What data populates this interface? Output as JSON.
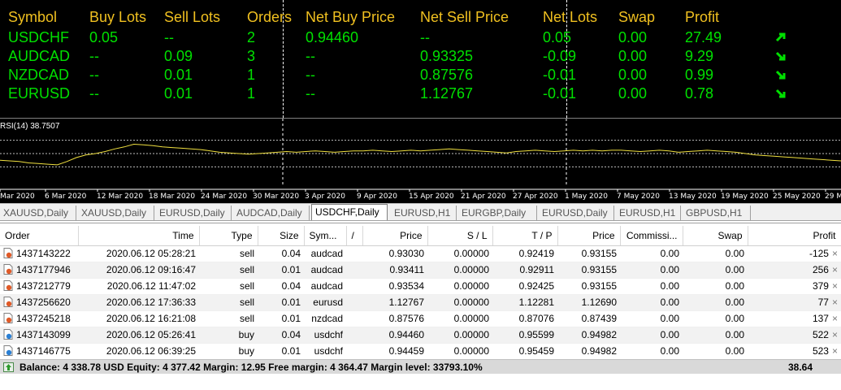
{
  "summary": {
    "headers": [
      "Symbol",
      "Buy Lots",
      "Sell Lots",
      "Orders",
      "Net Buy Price",
      "Net Sell Price",
      "Net Lots",
      "Swap",
      "Profit"
    ],
    "rows": [
      {
        "symbol": "USDCHF",
        "buy_lots": "0.05",
        "sell_lots": "--",
        "orders": "2",
        "net_buy_price": "0.94460",
        "net_sell_price": "--",
        "net_lots": "0.05",
        "swap": "0.00",
        "profit": "27.49",
        "arrow": "arrow-up-right-icon"
      },
      {
        "symbol": "AUDCAD",
        "buy_lots": "--",
        "sell_lots": "0.09",
        "orders": "3",
        "net_buy_price": "--",
        "net_sell_price": "0.93325",
        "net_lots": "-0.09",
        "swap": "0.00",
        "profit": "9.29",
        "arrow": "arrow-down-right-icon"
      },
      {
        "symbol": "NZDCAD",
        "buy_lots": "--",
        "sell_lots": "0.01",
        "orders": "1",
        "net_buy_price": "--",
        "net_sell_price": "0.87576",
        "net_lots": "-0.01",
        "swap": "0.00",
        "profit": "0.99",
        "arrow": "arrow-down-right-icon"
      },
      {
        "symbol": "EURUSD",
        "buy_lots": "--",
        "sell_lots": "0.01",
        "orders": "1",
        "net_buy_price": "--",
        "net_sell_price": "1.12767",
        "net_lots": "-0.01",
        "swap": "0.00",
        "profit": "0.78",
        "arrow": "arrow-down-right-icon"
      }
    ],
    "colors": {
      "header": "#f0c020",
      "value": "#00e000",
      "background": "#000000"
    }
  },
  "rsi": {
    "label": "RSI(14) 38.7507",
    "dates": [
      "Mar 2020",
      "6 Mar 2020",
      "12 Mar 2020",
      "18 Mar 2020",
      "24 Mar 2020",
      "30 Mar 2020",
      "3 Apr 2020",
      "9 Apr 2020",
      "15 Apr 2020",
      "21 Apr 2020",
      "27 Apr 2020",
      "1 May 2020",
      "7 May 2020",
      "13 May 2020",
      "19 May 2020",
      "25 May 2020",
      "29 M"
    ],
    "levels": [
      70,
      50,
      30
    ],
    "values": [
      40,
      39,
      38,
      36,
      35,
      34,
      33,
      38,
      44,
      48,
      50,
      53,
      57,
      60,
      64,
      63,
      62,
      60,
      59,
      58,
      57,
      56,
      54,
      52,
      51,
      50,
      49,
      50,
      51,
      52,
      53,
      52,
      53,
      54,
      53,
      52,
      53,
      54,
      54,
      55,
      54,
      53,
      54,
      55,
      54,
      55,
      56,
      57,
      56,
      55,
      54,
      53,
      52,
      51,
      53,
      54,
      55,
      54,
      53,
      54,
      55,
      54,
      55,
      54,
      55,
      55,
      54,
      53,
      54,
      55,
      54,
      52,
      53,
      54,
      55,
      54,
      53,
      52,
      50,
      48,
      47,
      46,
      45,
      44,
      43,
      42,
      41,
      40,
      39
    ],
    "line_color": "#f0e040"
  },
  "tabs": [
    {
      "label": "XAUUSD,Daily",
      "active": false
    },
    {
      "label": "XAUUSD,Daily",
      "active": false
    },
    {
      "label": "EURUSD,Daily",
      "active": false
    },
    {
      "label": "AUDCAD,Daily",
      "active": false
    },
    {
      "label": "USDCHF,Daily",
      "active": true
    },
    {
      "label": "EURUSD,H1",
      "active": false
    },
    {
      "label": "EURGBP,Daily",
      "active": false
    },
    {
      "label": "EURUSD,Daily",
      "active": false
    },
    {
      "label": "EURUSD,H1",
      "active": false
    },
    {
      "label": "GBPUSD,H1",
      "active": false
    }
  ],
  "orders": {
    "columns": [
      "Order",
      "Time",
      "Type",
      "Size",
      "Sym...",
      "/",
      "Price",
      "S / L",
      "T / P",
      "Price",
      "Commissi...",
      "Swap",
      "Profit"
    ],
    "rows": [
      {
        "order": "1437143222",
        "time": "2020.06.12 05:28:21",
        "type": "sell",
        "size": "0.04",
        "symbol": "audcad",
        "price": "0.93030",
        "sl": "0.00000",
        "tp": "0.92419",
        "cur_price": "0.93155",
        "commission": "0.00",
        "swap": "0.00",
        "profit": "-125",
        "icon": "sell-order-icon"
      },
      {
        "order": "1437177946",
        "time": "2020.06.12 09:16:47",
        "type": "sell",
        "size": "0.01",
        "symbol": "audcad",
        "price": "0.93411",
        "sl": "0.00000",
        "tp": "0.92911",
        "cur_price": "0.93155",
        "commission": "0.00",
        "swap": "0.00",
        "profit": "256",
        "icon": "sell-order-icon"
      },
      {
        "order": "1437212779",
        "time": "2020.06.12 11:47:02",
        "type": "sell",
        "size": "0.04",
        "symbol": "audcad",
        "price": "0.93534",
        "sl": "0.00000",
        "tp": "0.92425",
        "cur_price": "0.93155",
        "commission": "0.00",
        "swap": "0.00",
        "profit": "379",
        "icon": "sell-order-icon"
      },
      {
        "order": "1437256620",
        "time": "2020.06.12 17:36:33",
        "type": "sell",
        "size": "0.01",
        "symbol": "eurusd",
        "price": "1.12767",
        "sl": "0.00000",
        "tp": "1.12281",
        "cur_price": "1.12690",
        "commission": "0.00",
        "swap": "0.00",
        "profit": "77",
        "icon": "sell-order-icon"
      },
      {
        "order": "1437245218",
        "time": "2020.06.12 16:21:08",
        "type": "sell",
        "size": "0.01",
        "symbol": "nzdcad",
        "price": "0.87576",
        "sl": "0.00000",
        "tp": "0.87076",
        "cur_price": "0.87439",
        "commission": "0.00",
        "swap": "0.00",
        "profit": "137",
        "icon": "sell-order-icon"
      },
      {
        "order": "1437143099",
        "time": "2020.06.12 05:26:41",
        "type": "buy",
        "size": "0.04",
        "symbol": "usdchf",
        "price": "0.94460",
        "sl": "0.00000",
        "tp": "0.95599",
        "cur_price": "0.94982",
        "commission": "0.00",
        "swap": "0.00",
        "profit": "522",
        "icon": "buy-order-icon"
      },
      {
        "order": "1437146775",
        "time": "2020.06.12 06:39:25",
        "type": "buy",
        "size": "0.01",
        "symbol": "usdchf",
        "price": "0.94459",
        "sl": "0.00000",
        "tp": "0.95459",
        "cur_price": "0.94982",
        "commission": "0.00",
        "swap": "0.00",
        "profit": "523",
        "icon": "buy-order-icon"
      }
    ],
    "close_glyph": "×",
    "balance_text": "Balance: 4 338.78 USD  Equity: 4 377.42  Margin: 12.95  Free margin: 4 364.47  Margin level: 33793.10%",
    "balance_profit": "38.64"
  }
}
